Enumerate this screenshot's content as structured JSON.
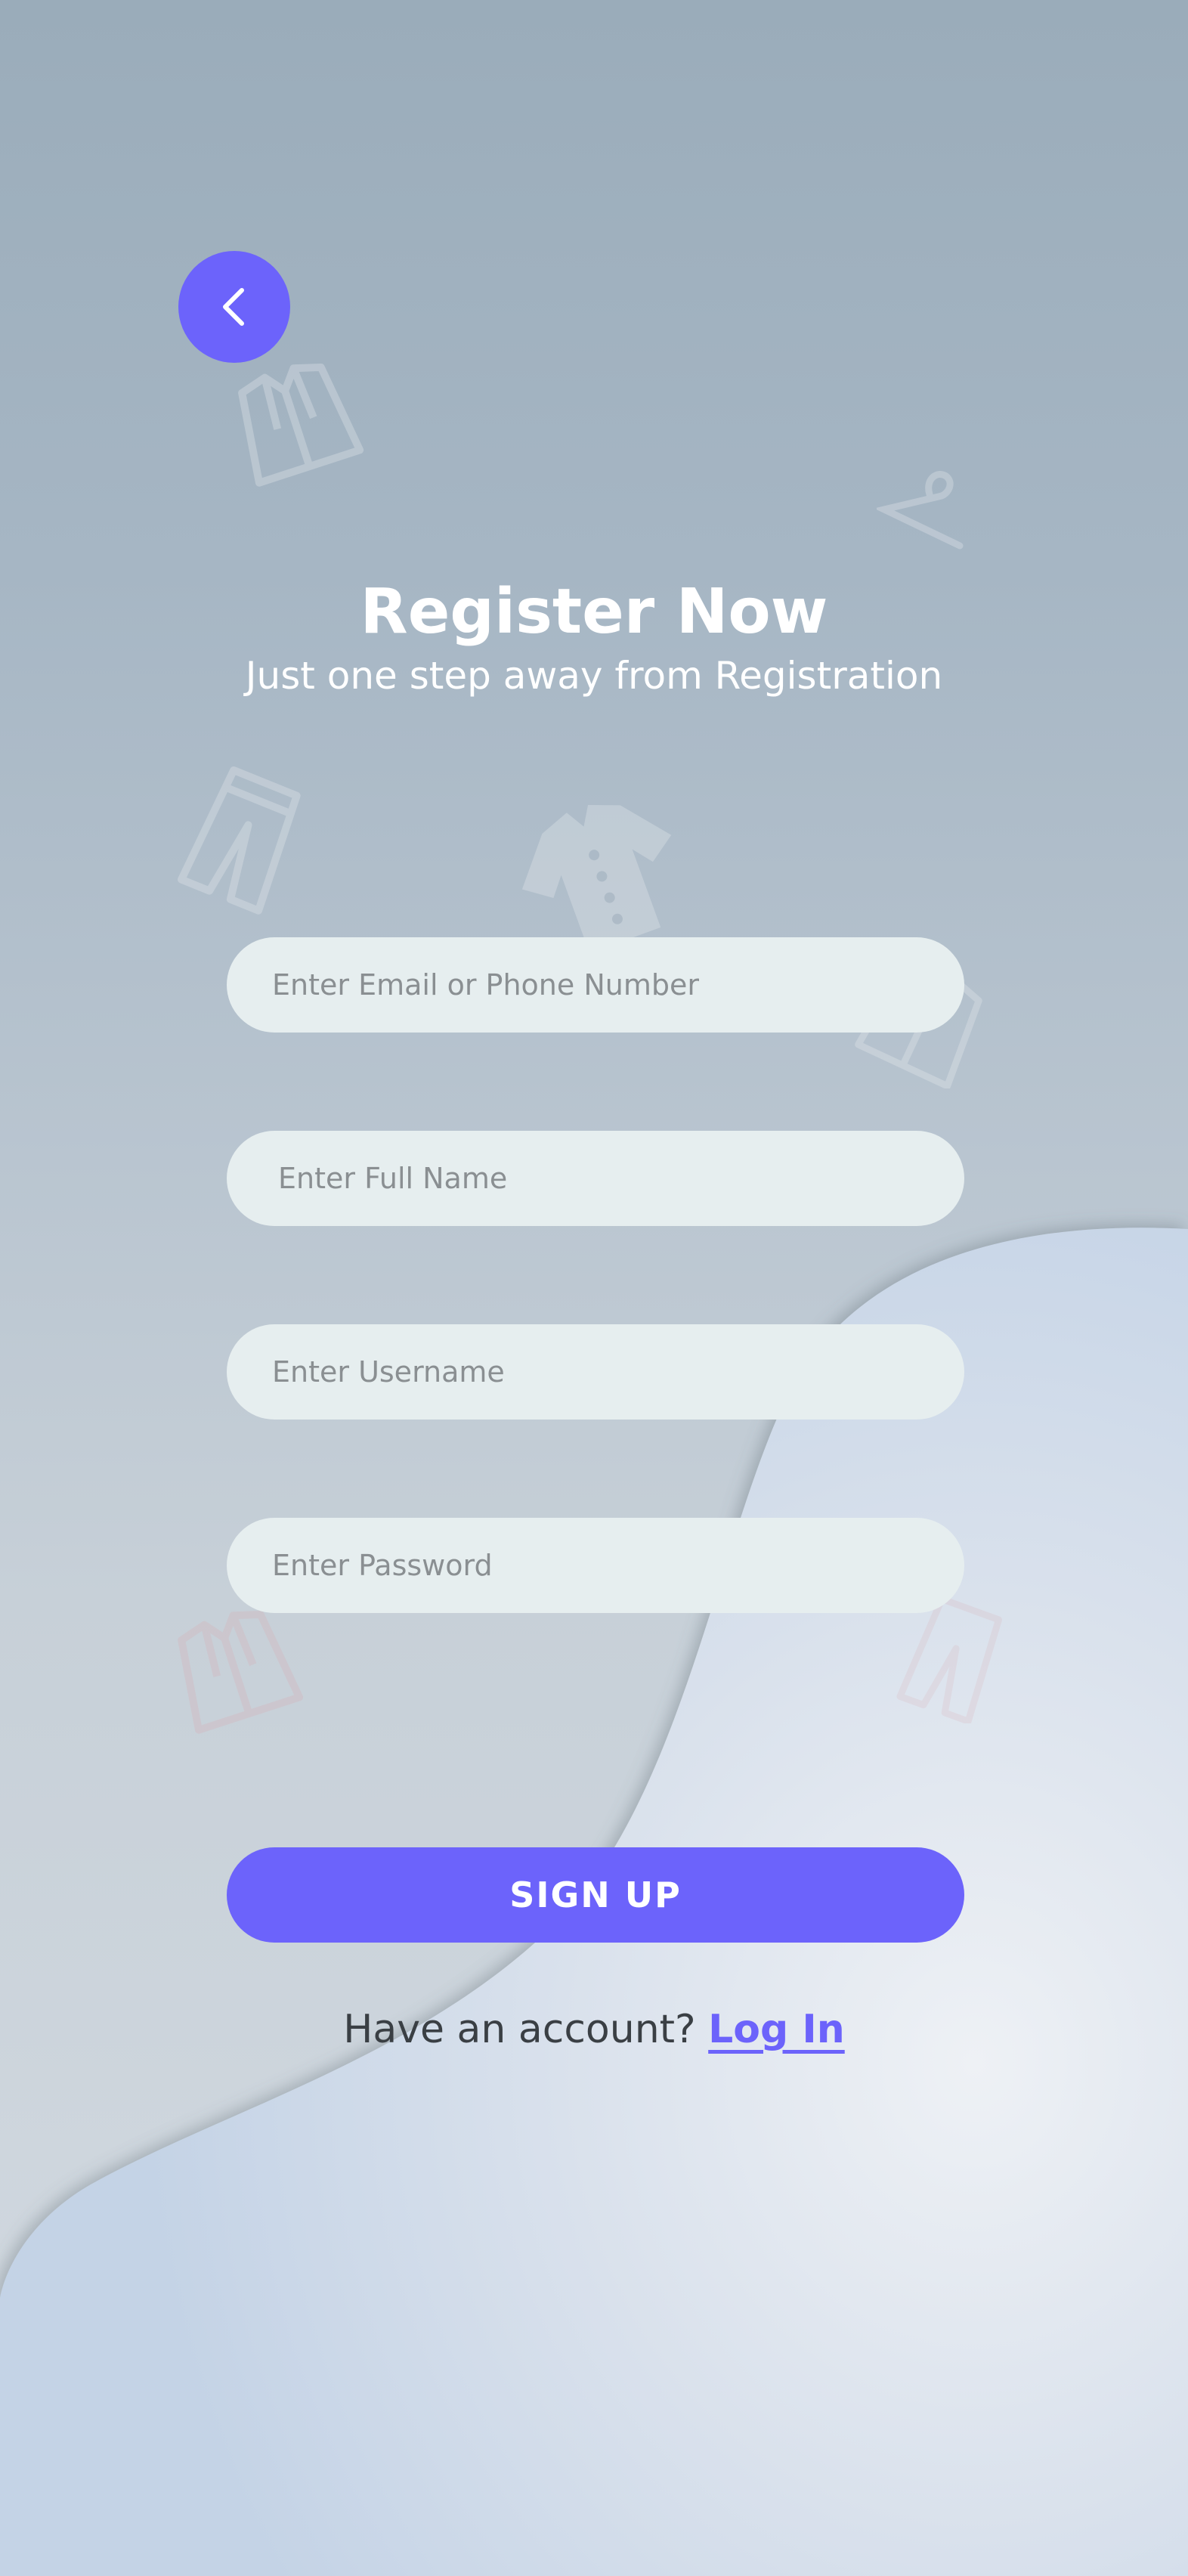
{
  "header": {
    "back_icon": "chevron-left-icon",
    "title": "Register Now",
    "subtitle": "Just one step away from Registration"
  },
  "form": {
    "email_placeholder": "Enter Email or Phone Number",
    "fullname_placeholder": "Enter Full Name",
    "username_placeholder": "Enter Username",
    "password_placeholder": "Enter Password"
  },
  "actions": {
    "signup_label": "SIGN UP",
    "login_prompt": "Have an account?",
    "login_label": "Log In"
  },
  "colors": {
    "accent": "#6c63fb",
    "field_background": "#e6eeef",
    "background_top": "#9aacba"
  },
  "decorations": [
    "jacket-icon",
    "hanger-icon",
    "pants-icon",
    "shirt-icon",
    "jacket-icon",
    "jacket-icon",
    "pants-icon"
  ]
}
